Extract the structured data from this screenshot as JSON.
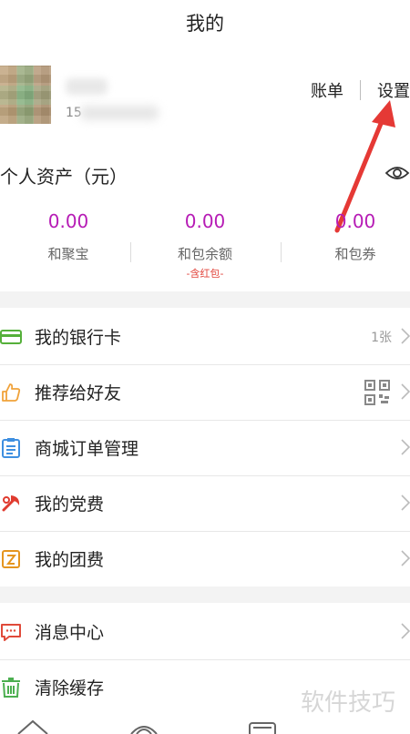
{
  "header": {
    "title": "我的"
  },
  "profile": {
    "phone_prefix": "15",
    "bill_label": "账单",
    "settings_label": "设置"
  },
  "assets": {
    "title": "个人资产（元）",
    "items": [
      {
        "value": "0.00",
        "label": "和聚宝",
        "sub": ""
      },
      {
        "value": "0.00",
        "label": "和包余额",
        "sub": "-含红包-"
      },
      {
        "value": "0.00",
        "label": "和包券",
        "sub": ""
      }
    ]
  },
  "menu_group1": [
    {
      "label": "我的银行卡",
      "right": "1张",
      "icon": "bank-card-icon"
    },
    {
      "label": "推荐给好友",
      "right": "",
      "icon": "thumbs-up-icon"
    },
    {
      "label": "商城订单管理",
      "right": "",
      "icon": "order-list-icon"
    },
    {
      "label": "我的党费",
      "right": "",
      "icon": "party-fee-icon"
    },
    {
      "label": "我的团费",
      "right": "",
      "icon": "league-fee-icon"
    }
  ],
  "menu_group2": [
    {
      "label": "消息中心",
      "right": "",
      "icon": "message-icon"
    },
    {
      "label": "清除缓存",
      "right": "",
      "icon": "trash-icon"
    }
  ],
  "watermark": "软件技巧",
  "colors": {
    "accent_value": "#b61bb5",
    "arrow": "#e53935",
    "red_text": "#e2463d"
  }
}
